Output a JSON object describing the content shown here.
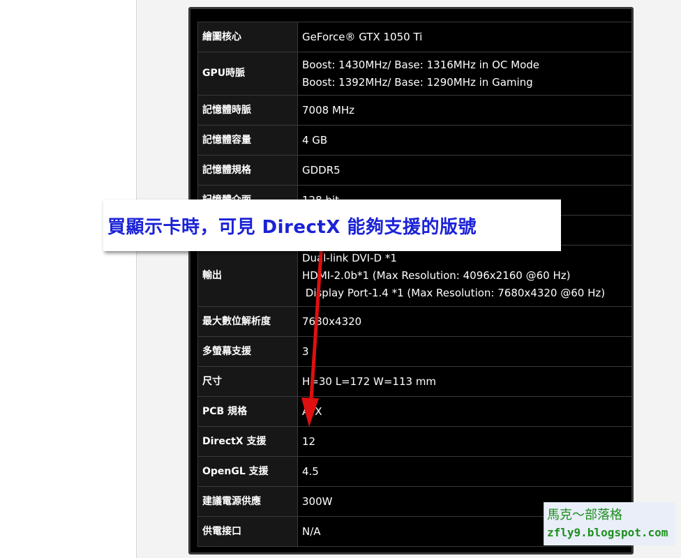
{
  "specs": {
    "rows": [
      {
        "key": "繪圖核心",
        "lines": [
          "GeForce® GTX 1050 Ti"
        ]
      },
      {
        "key": "GPU時脈",
        "lines": [
          "Boost: 1430MHz/ Base: 1316MHz in OC Mode",
          "Boost: 1392MHz/ Base: 1290MHz in Gaming"
        ]
      },
      {
        "key": "記憶體時脈",
        "lines": [
          "7008 MHz"
        ]
      },
      {
        "key": "記憶體容量",
        "lines": [
          "4 GB"
        ]
      },
      {
        "key": "記憶體規格",
        "lines": [
          "GDDR5"
        ]
      },
      {
        "key": "記憶體介面",
        "lines": [
          "128 bit"
        ]
      },
      {
        "key": "",
        "lines": [
          ""
        ]
      },
      {
        "key": "輸出",
        "lines": [
          "Dual-link DVI-D *1",
          "HDMI-2.0b*1 (Max Resolution: 4096x2160 @60 Hz)",
          " Display Port-1.4 *1 (Max Resolution: 7680x4320 @60 Hz)"
        ]
      },
      {
        "key": "最大數位解析度",
        "lines": [
          "7680x4320"
        ]
      },
      {
        "key": "多螢幕支援",
        "lines": [
          "3"
        ]
      },
      {
        "key": "尺寸",
        "lines": [
          "H=30 L=172 W=113 mm"
        ]
      },
      {
        "key": "PCB 規格",
        "lines": [
          "ATX"
        ]
      },
      {
        "key": "DirectX 支援",
        "lines": [
          "12"
        ]
      },
      {
        "key": "OpenGL 支援",
        "lines": [
          "4.5"
        ]
      },
      {
        "key": "建議電源供應",
        "lines": [
          "300W"
        ]
      },
      {
        "key": "供電接口",
        "lines": [
          "N/A"
        ]
      }
    ]
  },
  "callout": {
    "text": "買顯示卡時，可見 DirectX 能夠支援的版號",
    "color": "#1b22d6"
  },
  "annotation": {
    "arrow_color": "#e01010"
  },
  "watermark": {
    "line1": "馬克～部落格",
    "line2": "zfly9.blogspot.com"
  }
}
